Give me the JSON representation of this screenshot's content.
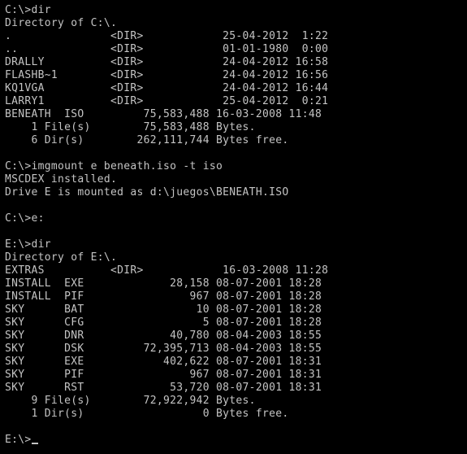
{
  "terminal": {
    "lines": [
      "C:\\>dir",
      "Directory of C:\\.",
      ".               <DIR>            25-04-2012  1:22",
      "..              <DIR>            01-01-1980  0:00",
      "DRALLY          <DIR>            24-04-2012 16:58",
      "FLASHB~1        <DIR>            24-04-2012 16:56",
      "KQ1VGA          <DIR>            24-04-2012 16:44",
      "LARRY1          <DIR>            25-04-2012  0:21",
      "BENEATH  ISO         75,583,488 16-03-2008 11:48",
      "    1 File(s)        75,583,488 Bytes.",
      "    6 Dir(s)        262,111,744 Bytes free.",
      "",
      "C:\\>imgmount e beneath.iso -t iso",
      "MSCDEX installed.",
      "Drive E is mounted as d:\\juegos\\BENEATH.ISO",
      "",
      "C:\\>e:",
      "",
      "E:\\>dir",
      "Directory of E:\\.",
      "EXTRAS          <DIR>            16-03-2008 11:28",
      "INSTALL  EXE             28,158 08-07-2001 18:28",
      "INSTALL  PIF                967 08-07-2001 18:28",
      "SKY      BAT                 10 08-07-2001 18:28",
      "SKY      CFG                  5 08-07-2001 18:28",
      "SKY      DNR             40,780 08-04-2003 18:55",
      "SKY      DSK         72,395,713 08-04-2003 18:55",
      "SKY      EXE            402,622 08-07-2001 18:31",
      "SKY      PIF                967 08-07-2001 18:31",
      "SKY      RST             53,720 08-07-2001 18:31",
      "    9 File(s)        72,922,942 Bytes.",
      "    1 Dir(s)                  0 Bytes free.",
      "",
      "E:\\>"
    ]
  },
  "colors": {
    "background": "#000000",
    "text": "#c4c4c4"
  }
}
